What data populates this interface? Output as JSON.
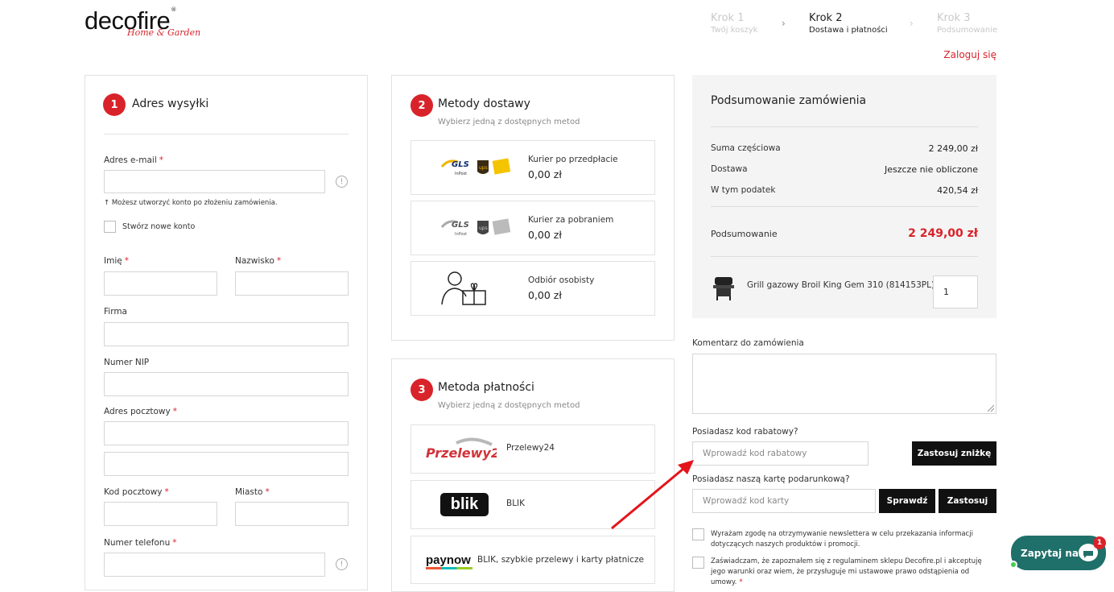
{
  "header": {
    "logo_text": "decofire",
    "logo_sub": "Home & Garden",
    "steps": [
      {
        "title": "Krok 1",
        "sub": "Twój koszyk"
      },
      {
        "title": "Krok 2",
        "sub": "Dostawa i płatności"
      },
      {
        "title": "Krok 3",
        "sub": "Podsumowanie"
      }
    ],
    "login": "Zaloguj się"
  },
  "address": {
    "num": "1",
    "title": "Adres wysyłki",
    "email_label": "Adres e-mail",
    "email_hint": "Możesz utworzyć konto po złożeniu zamówienia.",
    "create_account": "Stwórz nowe konto",
    "first_name": "Imię",
    "last_name": "Nazwisko",
    "company": "Firma",
    "nip": "Numer NIP",
    "postal_address": "Adres pocztowy",
    "postal_code": "Kod pocztowy",
    "city": "Miasto",
    "phone": "Numer telefonu",
    "req": "*"
  },
  "delivery": {
    "num": "2",
    "title": "Metody dostawy",
    "subtitle": "Wybierz jedną z dostępnych metod",
    "options": [
      {
        "label": "Kurier po przedpłacie",
        "price": "0,00 zł"
      },
      {
        "label": "Kurier za pobraniem",
        "price": "0,00 zł"
      },
      {
        "label": "Odbiór osobisty",
        "price": "0,00 zł"
      }
    ],
    "logos": {
      "gls": "GLS",
      "inpost": "InPost",
      "ups": "ups"
    }
  },
  "payment": {
    "num": "3",
    "title": "Metoda płatności",
    "subtitle": "Wybierz jedną z dostępnych metod",
    "options": [
      {
        "logo": "Przelewy24",
        "label": "Przelewy24"
      },
      {
        "logo": "blik",
        "label": "BLIK"
      },
      {
        "logo": "paynow",
        "label": "BLIK, szybkie przelewy i karty płatnicze"
      }
    ]
  },
  "summary": {
    "title": "Podsumowanie zamówienia",
    "rows": [
      {
        "label": "Suma częściowa",
        "value": "2 249,00 zł"
      },
      {
        "label": "Dostawa",
        "value": "Jeszcze nie obliczone"
      },
      {
        "label": "W tym podatek",
        "value": "420,54 zł"
      }
    ],
    "total_label": "Podsumowanie",
    "total_value": "2 249,00 zł",
    "product_name": "Grill gazowy Broil King Gem 310 (814153PL)",
    "product_qty": "1"
  },
  "comment_label": "Komentarz do zamówienia",
  "discount": {
    "label": "Posiadasz kod rabatowy?",
    "placeholder": "Wprowadź kod rabatowy",
    "apply": "Zastosuj zniżkę"
  },
  "giftcard": {
    "label": "Posiadasz naszą kartę podarunkową?",
    "placeholder": "Wprowadź kod karty",
    "check": "Sprawdź",
    "apply": "Zastosuj"
  },
  "consents": {
    "newsletter": "Wyrażam zgodę na otrzymywanie newslettera w celu przekazania informacji dotyczących naszych produktów i promocji.",
    "terms": "Zaświadczam, że zapoznałem się z regulaminem sklepu Decofire.pl i akceptuję jego warunki oraz wiem, że przysługuje mi ustawowe prawo odstąpienia od umowy."
  },
  "chat": {
    "label": "Zapytaj nas",
    "badge": "1"
  },
  "colors": {
    "accent": "#d9232a",
    "chat": "#1f6f6a",
    "dark": "#111111"
  }
}
